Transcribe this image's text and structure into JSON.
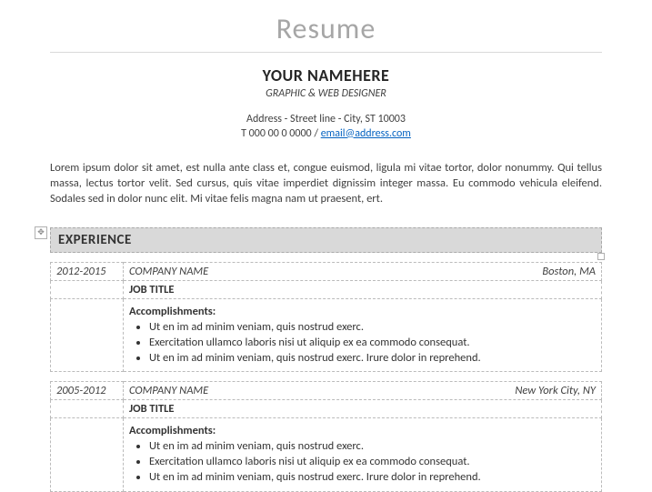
{
  "topTitle": "Resume",
  "name": "YOUR NAMEHERE",
  "role": "GRAPHIC & WEB DESIGNER",
  "address": "Address - Street line - City, ST 10003",
  "phone": "T 000 00 0 0000",
  "sep": "  /  ",
  "email": "email@address.com",
  "summary": "Lorem ipsum dolor sit amet, est nulla ante class et, congue euismod, ligula mi vitae tortor, dolor nonummy. Qui tellus massa, lectus tortor velit. Sed cursus, quis vitae imperdiet dignissim integer massa. Eu commodo vehicula eleifend. Sodales sed in dolor nunc elit. Mi vitae felis magna nam ut praesent, ert.",
  "sectionLabel": "EXPERIENCE",
  "jobs": [
    {
      "dates": "2012-2015",
      "company": "COMPANY NAME",
      "location": "Boston, MA",
      "title": "JOB TITLE",
      "accLabel": "Accomplishments:",
      "bullets": [
        "Ut en im ad minim veniam, quis nostrud exerc.",
        "Exercitation ullamco laboris nisi ut aliquip ex ea commodo consequat.",
        "Ut en im ad minim veniam, quis nostrud exerc. Irure dolor in reprehend."
      ]
    },
    {
      "dates": "2005-2012",
      "company": "COMPANY NAME",
      "location": "New York City, NY",
      "title": "JOB TITLE",
      "accLabel": "Accomplishments:",
      "bullets": [
        "Ut en im ad minim veniam, quis nostrud exerc.",
        "Exercitation ullamco laboris nisi ut aliquip ex ea commodo consequat.",
        "Ut en im ad minim veniam, quis nostrud exerc. Irure dolor in reprehend."
      ]
    }
  ]
}
